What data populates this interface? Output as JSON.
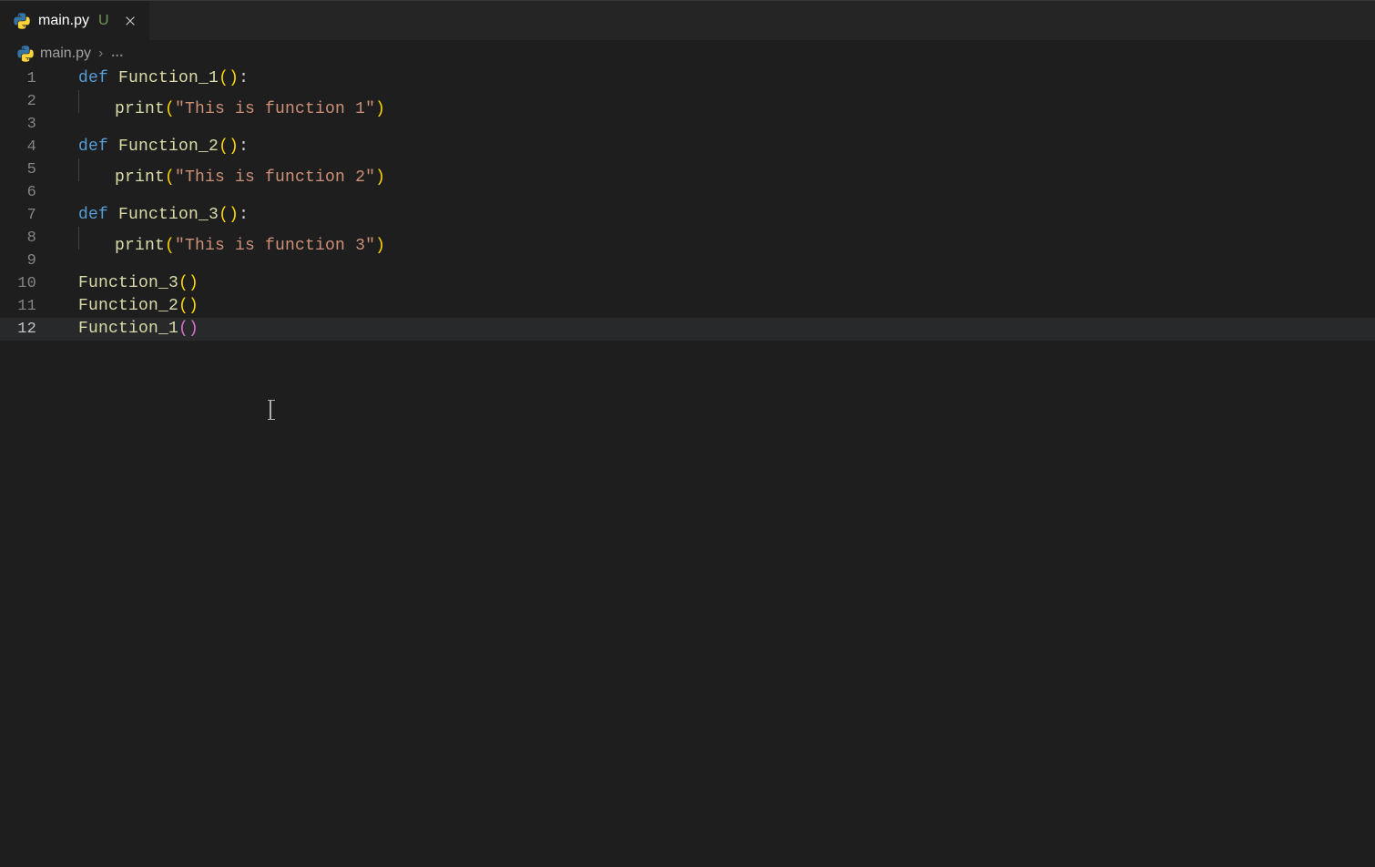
{
  "tab": {
    "filename": "main.py",
    "status": "U",
    "close_icon": "×"
  },
  "breadcrumb": {
    "filename": "main.py",
    "separator": "›",
    "more": "..."
  },
  "gutter": {
    "l1": "1",
    "l2": "2",
    "l3": "3",
    "l4": "4",
    "l5": "5",
    "l6": "6",
    "l7": "7",
    "l8": "8",
    "l9": "9",
    "l10": "10",
    "l11": "11",
    "l12": "12"
  },
  "code": {
    "def": "def",
    "print": "print",
    "fn1": "Function_1",
    "fn2": "Function_2",
    "fn3": "Function_3",
    "paren_open": "(",
    "paren_close": ")",
    "colon": ":",
    "str1": "\"This is function 1\"",
    "str2": "\"This is function 2\"",
    "str3": "\"This is function 3\"",
    "indent": "    "
  },
  "colors": {
    "background": "#1e1e1e",
    "keyword": "#569cd6",
    "function": "#dcdcaa",
    "string": "#ce9178",
    "bracket_yellow": "#ffd700",
    "bracket_purple": "#da70d6",
    "line_number": "#858585"
  }
}
